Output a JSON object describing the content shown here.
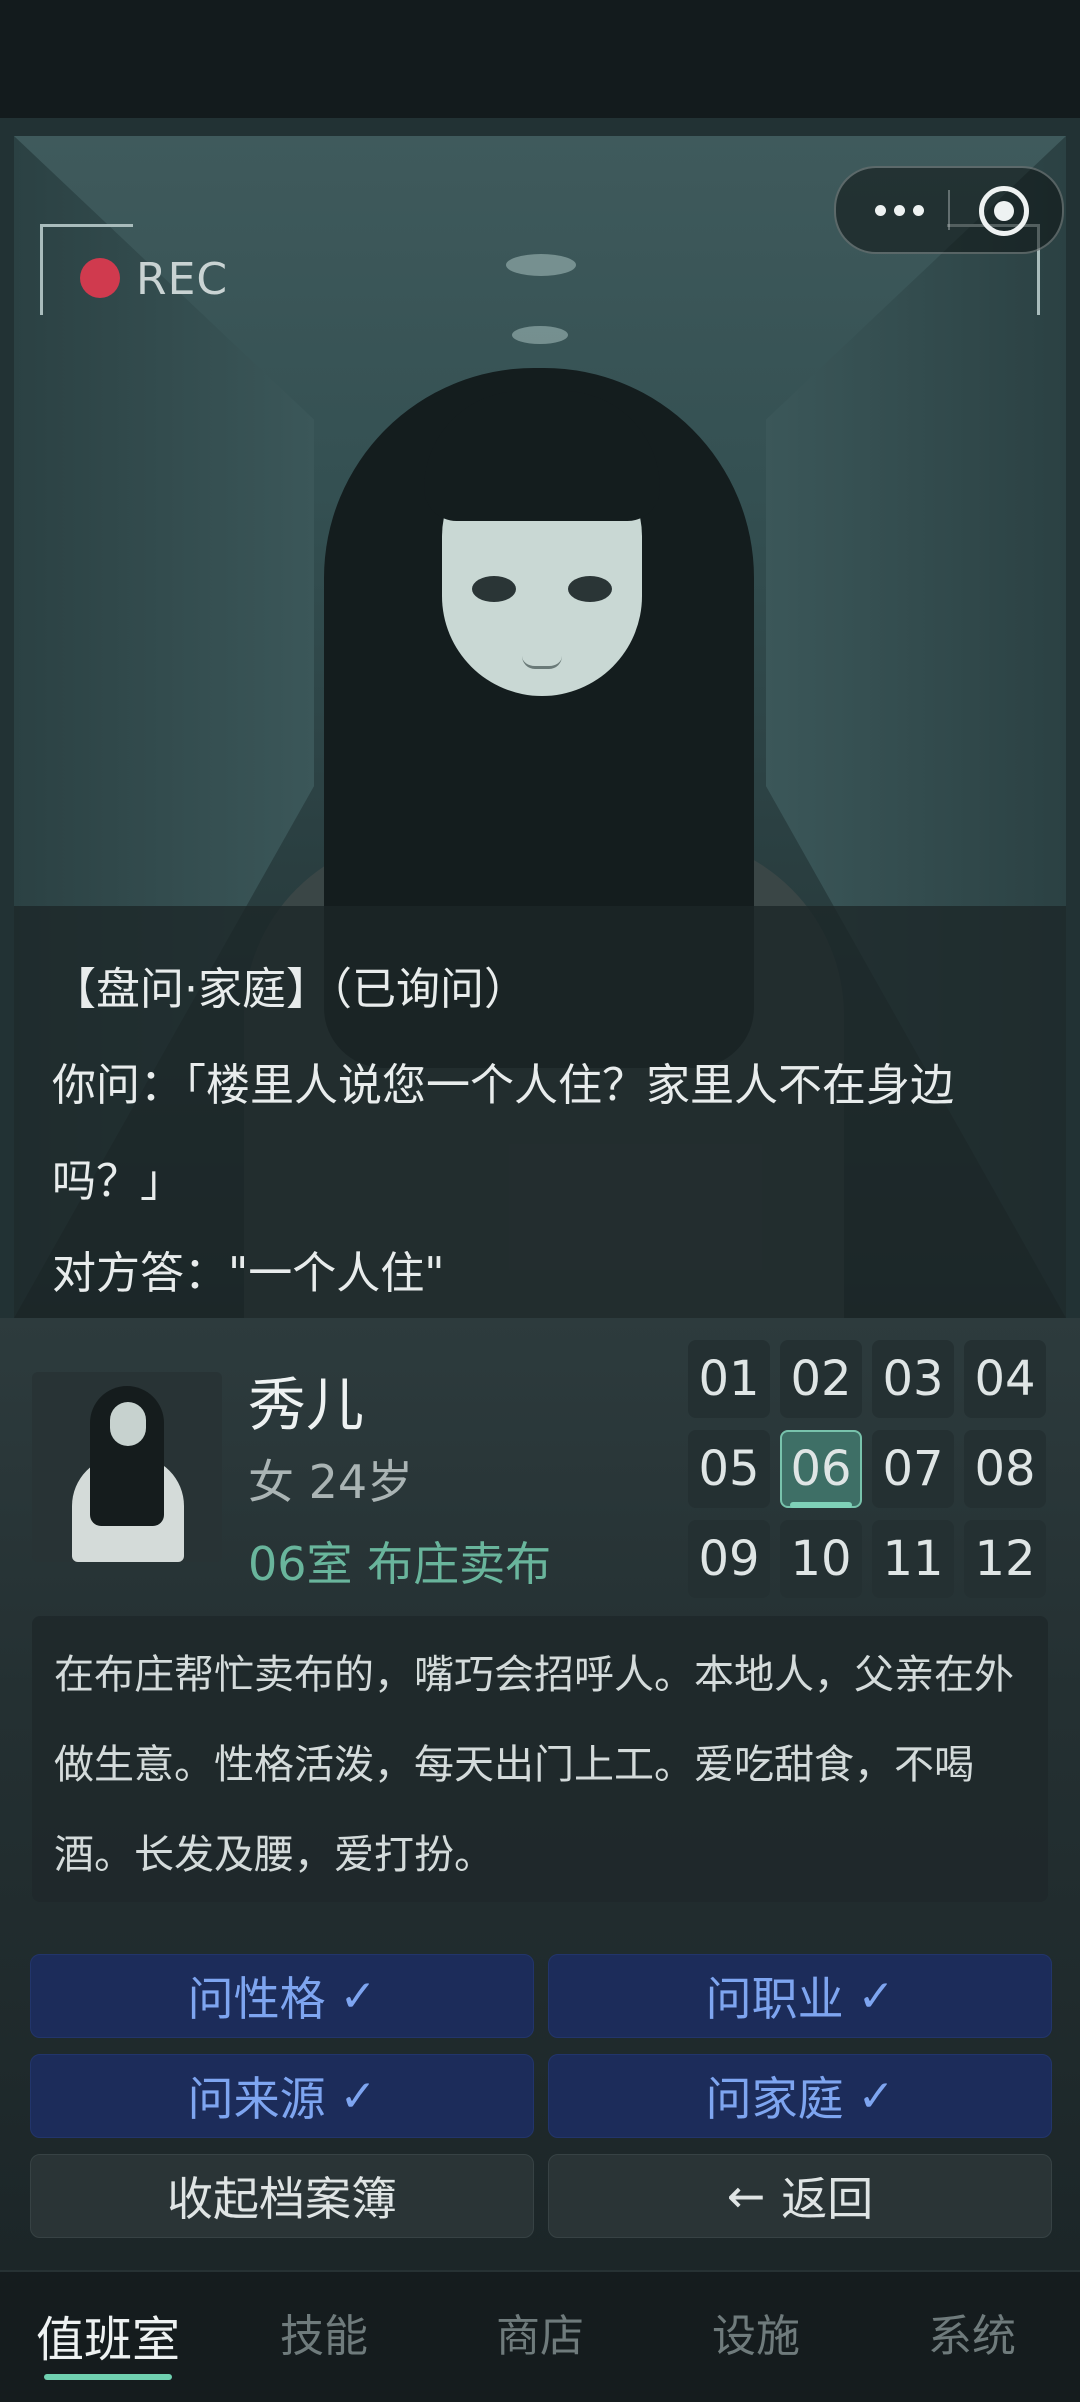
{
  "scene": {
    "rec_label": "REC",
    "dialog": {
      "tag": "【盘问·家庭】（已询问）",
      "question": "你问：「楼里人说您一个人住？家里人不在身边吗？」",
      "answer": "对方答：\"一个人住\""
    },
    "capsule": {
      "more_icon": "more-dots-icon",
      "close_icon": "target-circle-icon"
    }
  },
  "character": {
    "name": "秀儿",
    "gender_age": "女 24岁",
    "room_job": "06室  布庄卖布",
    "description": "在布庄帮忙卖布的，嘴巧会招呼人。本地人，父亲在外做生意。性格活泼，每天出门上工。爱吃甜食，不喝酒。长发及腰，爱打扮。"
  },
  "rooms": {
    "items": [
      "01",
      "02",
      "03",
      "04",
      "05",
      "06",
      "07",
      "08",
      "09",
      "10",
      "11",
      "12"
    ],
    "selected": "06"
  },
  "questions": {
    "personality": "问性格",
    "occupation": "问职业",
    "origin": "问来源",
    "family": "问家庭",
    "check_glyph": "✓"
  },
  "actions": {
    "collapse": "收起档案簿",
    "back_arrow": "←",
    "back": "返回"
  },
  "nav": {
    "items": [
      "值班室",
      "技能",
      "商店",
      "设施",
      "系统"
    ],
    "active": "值班室"
  },
  "colors": {
    "accent_green": "#6fd0b0",
    "question_button_bg": "#1c2c5a",
    "question_button_text": "#7ea5f0",
    "rec_dot": "#d03a4e"
  }
}
